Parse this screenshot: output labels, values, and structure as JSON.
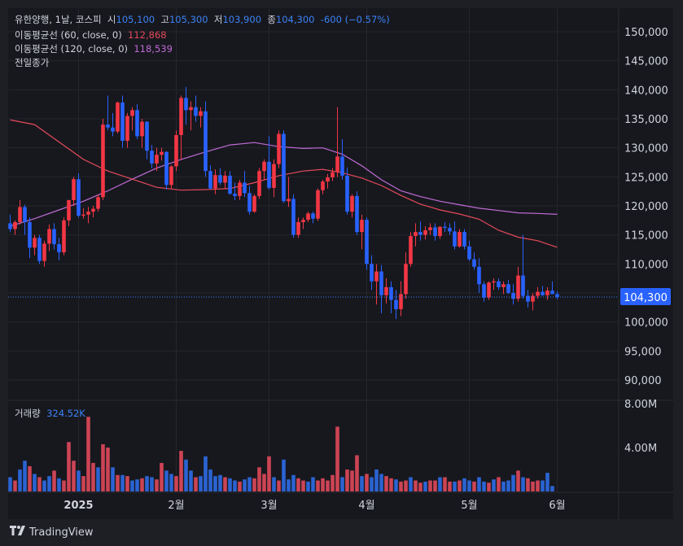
{
  "header": {
    "symbol": "유한양행",
    "interval": "1날",
    "exchange": "코스피",
    "open_label": "시",
    "open": "105,100",
    "high_label": "고",
    "high": "105,300",
    "low_label": "저",
    "low": "103,900",
    "close_label": "종",
    "close": "104,300",
    "change": "-600",
    "change_pct": "(−0.57%)"
  },
  "indicators": [
    {
      "label": "이동평균선 (60, close, 0)",
      "value": "112,868",
      "color": "#e54a5a"
    },
    {
      "label": "이동평균선 (120, close, 0)",
      "value": "118,539",
      "color": "#c06bd6"
    },
    {
      "label": "전일종가",
      "value": "",
      "color": "#3b82f6"
    }
  ],
  "volume": {
    "label": "거래량",
    "value": "324.52K"
  },
  "price_badge": "104,300",
  "footer": {
    "brand": "TradingView"
  },
  "colors": {
    "up": "#f23645",
    "down": "#2962ff",
    "ma60": "#e54a5a",
    "ma120": "#c06bd6",
    "prev_close": "#3b82f6",
    "vol_up": "#e0495a",
    "vol_down": "#2e6be6"
  },
  "chart_data": {
    "type": "candlestick",
    "y_ticks": [
      "150,000",
      "145,000",
      "140,000",
      "135,000",
      "130,000",
      "125,000",
      "120,000",
      "115,000",
      "110,000",
      "105,000",
      "100,000",
      "95,000",
      "90,000"
    ],
    "y_tick_values": [
      150000,
      145000,
      140000,
      135000,
      130000,
      125000,
      120000,
      115000,
      110000,
      105000,
      100000,
      95000,
      90000
    ],
    "volume_ticks": [
      "8.00M",
      "4.00M"
    ],
    "volume_tick_values": [
      8000000,
      4000000
    ],
    "x_labels": [
      {
        "text": "2025",
        "index": 14
      },
      {
        "text": "2월",
        "index": 34
      },
      {
        "text": "3월",
        "index": 53
      },
      {
        "text": "4월",
        "index": 73
      },
      {
        "text": "5월",
        "index": 94
      },
      {
        "text": "6월",
        "index": 112
      }
    ],
    "prev_close": 104300,
    "ma60": [
      [
        0,
        134800
      ],
      [
        5,
        134000
      ],
      [
        10,
        131000
      ],
      [
        15,
        128000
      ],
      [
        20,
        126000
      ],
      [
        25,
        124600
      ],
      [
        30,
        123200
      ],
      [
        35,
        122700
      ],
      [
        40,
        122800
      ],
      [
        45,
        123000
      ],
      [
        50,
        124000
      ],
      [
        55,
        125200
      ],
      [
        60,
        126000
      ],
      [
        64,
        126300
      ],
      [
        68,
        125700
      ],
      [
        72,
        124800
      ],
      [
        76,
        123500
      ],
      [
        80,
        121800
      ],
      [
        84,
        120300
      ],
      [
        88,
        119300
      ],
      [
        92,
        118600
      ],
      [
        96,
        117700
      ],
      [
        100,
        115800
      ],
      [
        104,
        114600
      ],
      [
        108,
        114000
      ],
      [
        112,
        112868
      ]
    ],
    "ma120": [
      [
        0,
        116500
      ],
      [
        5,
        117800
      ],
      [
        10,
        119300
      ],
      [
        15,
        120800
      ],
      [
        20,
        122600
      ],
      [
        25,
        124600
      ],
      [
        30,
        126500
      ],
      [
        35,
        128000
      ],
      [
        40,
        129300
      ],
      [
        45,
        130500
      ],
      [
        50,
        130900
      ],
      [
        55,
        130200
      ],
      [
        60,
        129900
      ],
      [
        64,
        130000
      ],
      [
        68,
        128900
      ],
      [
        72,
        126900
      ],
      [
        76,
        124500
      ],
      [
        80,
        122600
      ],
      [
        84,
        121600
      ],
      [
        88,
        120800
      ],
      [
        92,
        120200
      ],
      [
        96,
        119600
      ],
      [
        100,
        119200
      ],
      [
        104,
        118800
      ],
      [
        108,
        118700
      ],
      [
        112,
        118539
      ]
    ],
    "candles": [
      [
        117000,
        118500,
        115500,
        116000
      ],
      [
        116000,
        117500,
        115000,
        117200
      ],
      [
        117200,
        121000,
        116800,
        119800
      ],
      [
        119800,
        120200,
        115000,
        117200
      ],
      [
        117200,
        118000,
        111000,
        112800
      ],
      [
        112800,
        115000,
        111500,
        114500
      ],
      [
        114500,
        115000,
        110000,
        110500
      ],
      [
        110500,
        114000,
        109500,
        113500
      ],
      [
        113500,
        116800,
        112200,
        116000
      ],
      [
        116000,
        117000,
        112500,
        113400
      ],
      [
        113400,
        114500,
        110600,
        112000
      ],
      [
        112000,
        118000,
        111500,
        117500
      ],
      [
        117500,
        121000,
        116500,
        121000
      ],
      [
        121000,
        125000,
        120000,
        124600
      ],
      [
        124600,
        125600,
        118000,
        118300
      ],
      [
        118300,
        119600,
        117800,
        118500
      ],
      [
        118500,
        119800,
        117000,
        119000
      ],
      [
        119000,
        120000,
        118000,
        119500
      ],
      [
        119500,
        122000,
        119000,
        121500
      ],
      [
        121500,
        135000,
        121000,
        134000
      ],
      [
        134000,
        139000,
        133000,
        133500
      ],
      [
        133500,
        136000,
        132000,
        132800
      ],
      [
        132800,
        138000,
        132500,
        137800
      ],
      [
        137800,
        139000,
        130000,
        131200
      ],
      [
        131200,
        136000,
        130000,
        135500
      ],
      [
        135500,
        137000,
        133000,
        136500
      ],
      [
        136500,
        137500,
        131500,
        132000
      ],
      [
        132000,
        135000,
        130000,
        134500
      ],
      [
        134500,
        134600,
        128000,
        129500
      ],
      [
        129500,
        130500,
        126500,
        127300
      ],
      [
        127300,
        130000,
        126000,
        128800
      ],
      [
        128800,
        130000,
        127800,
        129300
      ],
      [
        129300,
        129400,
        122800,
        123600
      ],
      [
        123600,
        127000,
        123000,
        126800
      ],
      [
        126800,
        133000,
        126000,
        132200
      ],
      [
        132200,
        139000,
        128000,
        138600
      ],
      [
        138600,
        140500,
        134000,
        136500
      ],
      [
        136500,
        138000,
        133000,
        137000
      ],
      [
        137000,
        139000,
        134500,
        135500
      ],
      [
        135500,
        137000,
        133500,
        136300
      ],
      [
        136300,
        138000,
        125000,
        126000
      ],
      [
        126000,
        127000,
        122800,
        123000
      ],
      [
        123000,
        126300,
        122000,
        125300
      ],
      [
        125300,
        126500,
        123600,
        124000
      ],
      [
        124000,
        126000,
        123000,
        125200
      ],
      [
        125200,
        126000,
        121900,
        122100
      ],
      [
        122100,
        124000,
        121000,
        121700
      ],
      [
        121700,
        124500,
        121000,
        124000
      ],
      [
        124000,
        126000,
        121500,
        122200
      ],
      [
        122200,
        123500,
        118500,
        119000
      ],
      [
        119000,
        122000,
        118800,
        121700
      ],
      [
        121700,
        126500,
        121200,
        126000
      ],
      [
        126000,
        128000,
        124500,
        127600
      ],
      [
        127600,
        132000,
        122800,
        123100
      ],
      [
        123100,
        128000,
        121500,
        127200
      ],
      [
        127200,
        133000,
        126500,
        132400
      ],
      [
        132400,
        133000,
        120500,
        120800
      ],
      [
        120800,
        125000,
        119800,
        121200
      ],
      [
        121200,
        122000,
        114500,
        115000
      ],
      [
        115000,
        118000,
        114500,
        117200
      ],
      [
        117200,
        118000,
        116000,
        117600
      ],
      [
        117600,
        119000,
        117200,
        118700
      ],
      [
        118700,
        119000,
        117000,
        117800
      ],
      [
        117800,
        123000,
        117400,
        122700
      ],
      [
        122700,
        124500,
        122000,
        124200
      ],
      [
        124200,
        125500,
        123000,
        124900
      ],
      [
        124900,
        126500,
        124300,
        125800
      ],
      [
        125800,
        137000,
        125000,
        128500
      ],
      [
        128500,
        131500,
        124500,
        125200
      ],
      [
        125200,
        126600,
        118500,
        119000
      ],
      [
        119000,
        122000,
        118000,
        121700
      ],
      [
        121700,
        122500,
        115000,
        115500
      ],
      [
        115500,
        118500,
        112500,
        117600
      ],
      [
        117600,
        118000,
        109000,
        110000
      ],
      [
        110000,
        111500,
        105500,
        107000
      ],
      [
        107000,
        110000,
        103000,
        108700
      ],
      [
        108700,
        109800,
        101500,
        104600
      ],
      [
        104600,
        107500,
        103200,
        106000
      ],
      [
        106000,
        107000,
        101500,
        103800
      ],
      [
        103800,
        105500,
        100500,
        102200
      ],
      [
        102200,
        107000,
        101000,
        104800
      ],
      [
        104800,
        112000,
        104000,
        110000
      ],
      [
        110000,
        115500,
        109500,
        114800
      ],
      [
        114800,
        117000,
        113000,
        115500
      ],
      [
        115500,
        117300,
        114000,
        115000
      ],
      [
        115000,
        116500,
        114200,
        115800
      ],
      [
        115800,
        117000,
        115000,
        116300
      ],
      [
        116300,
        117000,
        114000,
        114800
      ],
      [
        114800,
        116500,
        114300,
        116400
      ],
      [
        116400,
        117200,
        115500,
        116200
      ],
      [
        116200,
        117000,
        115000,
        115600
      ],
      [
        115600,
        117300,
        112500,
        113000
      ],
      [
        113000,
        116000,
        112800,
        115500
      ],
      [
        115500,
        116000,
        112500,
        113000
      ],
      [
        113000,
        114000,
        110500,
        110800
      ],
      [
        110800,
        112000,
        109000,
        109500
      ],
      [
        109500,
        111000,
        105000,
        106500
      ],
      [
        106500,
        107000,
        103500,
        104200
      ],
      [
        104200,
        107000,
        103800,
        106800
      ],
      [
        106800,
        107500,
        105500,
        107000
      ],
      [
        107000,
        107500,
        105500,
        106000
      ],
      [
        106000,
        107000,
        104800,
        106500
      ],
      [
        106500,
        107200,
        104800,
        105000
      ],
      [
        105000,
        106500,
        103000,
        104000
      ],
      [
        104000,
        109500,
        103500,
        108000
      ],
      [
        108000,
        115000,
        104000,
        104500
      ],
      [
        104500,
        105500,
        102500,
        103500
      ],
      [
        103500,
        105000,
        102000,
        104500
      ],
      [
        104500,
        106000,
        104000,
        105200
      ],
      [
        105200,
        106200,
        104500,
        104600
      ],
      [
        104600,
        106000,
        103800,
        105400
      ],
      [
        105400,
        107000,
        104800,
        104800
      ],
      [
        104800,
        105300,
        103900,
        104300
      ]
    ],
    "volumes": [
      [
        1.3,
        0
      ],
      [
        1.0,
        1
      ],
      [
        2.0,
        0
      ],
      [
        2.8,
        0
      ],
      [
        2.3,
        1
      ],
      [
        1.6,
        0
      ],
      [
        1.3,
        1
      ],
      [
        1.0,
        0
      ],
      [
        1.4,
        0
      ],
      [
        1.9,
        1
      ],
      [
        1.2,
        0
      ],
      [
        1.0,
        1
      ],
      [
        4.5,
        1
      ],
      [
        2.8,
        1
      ],
      [
        1.9,
        0
      ],
      [
        1.4,
        1
      ],
      [
        6.8,
        1
      ],
      [
        2.6,
        1
      ],
      [
        2.2,
        0
      ],
      [
        4.3,
        1
      ],
      [
        4.0,
        1
      ],
      [
        2.2,
        0
      ],
      [
        1.5,
        1
      ],
      [
        1.5,
        0
      ],
      [
        1.4,
        1
      ],
      [
        1.0,
        0
      ],
      [
        1.1,
        0
      ],
      [
        1.2,
        1
      ],
      [
        1.4,
        0
      ],
      [
        1.3,
        0
      ],
      [
        1.1,
        1
      ],
      [
        2.6,
        1
      ],
      [
        1.9,
        0
      ],
      [
        1.6,
        0
      ],
      [
        1.4,
        1
      ],
      [
        3.7,
        1
      ],
      [
        2.9,
        0
      ],
      [
        1.9,
        0
      ],
      [
        1.3,
        1
      ],
      [
        1.4,
        0
      ],
      [
        3.2,
        0
      ],
      [
        2.0,
        0
      ],
      [
        1.4,
        0
      ],
      [
        1.5,
        0
      ],
      [
        1.3,
        1
      ],
      [
        1.2,
        0
      ],
      [
        1.0,
        0
      ],
      [
        0.9,
        1
      ],
      [
        1.1,
        0
      ],
      [
        1.3,
        0
      ],
      [
        1.2,
        1
      ],
      [
        2.2,
        1
      ],
      [
        1.6,
        1
      ],
      [
        3.2,
        1
      ],
      [
        1.3,
        0
      ],
      [
        1.0,
        1
      ],
      [
        2.9,
        0
      ],
      [
        1.1,
        0
      ],
      [
        1.5,
        0
      ],
      [
        1.2,
        1
      ],
      [
        1.0,
        1
      ],
      [
        0.9,
        0
      ],
      [
        1.3,
        0
      ],
      [
        1.0,
        1
      ],
      [
        1.2,
        1
      ],
      [
        1.0,
        1
      ],
      [
        1.5,
        1
      ],
      [
        5.9,
        1
      ],
      [
        1.3,
        0
      ],
      [
        2.0,
        1
      ],
      [
        1.9,
        1
      ],
      [
        3.3,
        1
      ],
      [
        1.4,
        0
      ],
      [
        1.6,
        1
      ],
      [
        1.3,
        0
      ],
      [
        2.0,
        0
      ],
      [
        1.6,
        0
      ],
      [
        1.4,
        1
      ],
      [
        1.2,
        1
      ],
      [
        1.1,
        0
      ],
      [
        0.9,
        1
      ],
      [
        1.0,
        1
      ],
      [
        1.3,
        0
      ],
      [
        1.0,
        1
      ],
      [
        0.8,
        1
      ],
      [
        0.9,
        0
      ],
      [
        1.0,
        1
      ],
      [
        1.0,
        1
      ],
      [
        1.3,
        0
      ],
      [
        1.3,
        1
      ],
      [
        0.9,
        1
      ],
      [
        0.9,
        0
      ],
      [
        1.0,
        1
      ],
      [
        1.2,
        0
      ],
      [
        1.0,
        0
      ],
      [
        0.9,
        1
      ],
      [
        1.3,
        0
      ],
      [
        0.9,
        0
      ],
      [
        0.8,
        1
      ],
      [
        1.1,
        0
      ],
      [
        1.3,
        1
      ],
      [
        0.9,
        0
      ],
      [
        1.0,
        0
      ],
      [
        1.5,
        0
      ],
      [
        1.9,
        1
      ],
      [
        1.3,
        0
      ],
      [
        1.2,
        1
      ],
      [
        0.9,
        1
      ],
      [
        1.0,
        1
      ],
      [
        1.0,
        0
      ],
      [
        1.7,
        0
      ],
      [
        0.5,
        0
      ]
    ]
  }
}
